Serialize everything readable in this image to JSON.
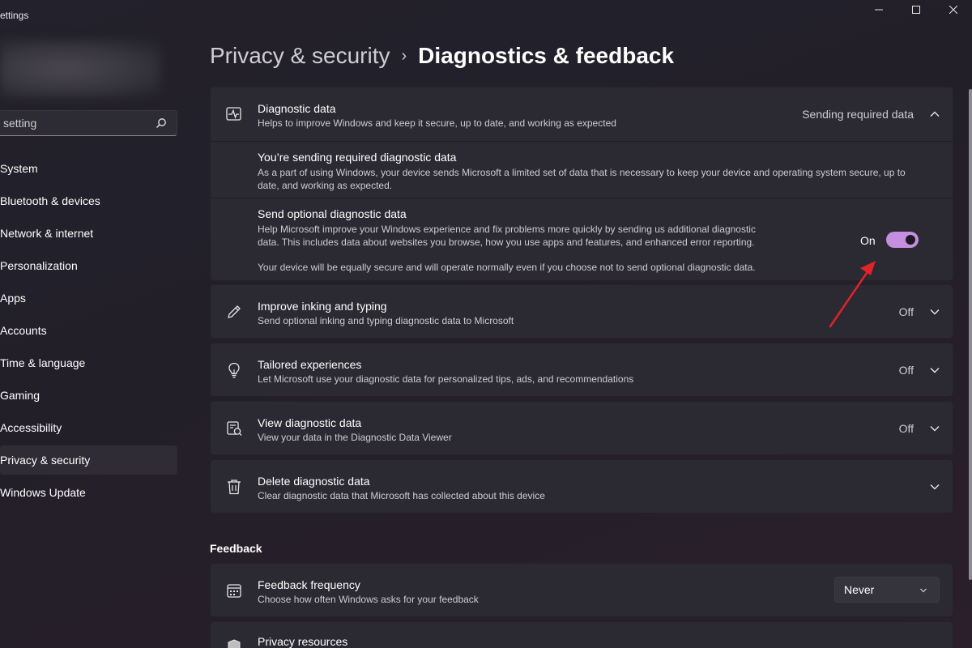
{
  "window": {
    "app_title": "ettings"
  },
  "sidebar": {
    "search_placeholder": "setting",
    "items": [
      {
        "label": "System"
      },
      {
        "label": "Bluetooth & devices"
      },
      {
        "label": "Network & internet"
      },
      {
        "label": "Personalization"
      },
      {
        "label": "Apps"
      },
      {
        "label": "Accounts"
      },
      {
        "label": "Time & language"
      },
      {
        "label": "Gaming"
      },
      {
        "label": "Accessibility"
      },
      {
        "label": "Privacy & security"
      },
      {
        "label": "Windows Update"
      }
    ],
    "active_index": 9
  },
  "breadcrumb": {
    "parent": "Privacy & security",
    "separator": "›",
    "current": "Diagnostics & feedback"
  },
  "diagnostic": {
    "title": "Diagnostic data",
    "desc": "Helps to improve Windows and keep it secure, up to date, and working as expected",
    "status": "Sending required data",
    "required": {
      "title": "You’re sending required diagnostic data",
      "line1": "As a part of using Windows, your device sends Microsoft a limited set of data that is necessary to keep your device and operating system secure, up to",
      "line2": "date, and working as expected."
    },
    "optional": {
      "title": "Send optional diagnostic data",
      "line1": "Help Microsoft improve your Windows experience and fix problems more quickly by sending us additional diagnostic",
      "line2": "data. This includes data about websites you browse, how you use apps and features, and enhanced error reporting.",
      "note": "Your device will be equally secure and will operate normally even if you choose not to send optional diagnostic data.",
      "toggle_label": "On"
    }
  },
  "inking": {
    "title": "Improve inking and typing",
    "desc": "Send optional inking and typing diagnostic data to Microsoft",
    "status": "Off"
  },
  "tailored": {
    "title": "Tailored experiences",
    "desc": "Let Microsoft use your diagnostic data for personalized tips, ads, and recommendations",
    "status": "Off"
  },
  "viewdata": {
    "title": "View diagnostic data",
    "desc": "View your data in the Diagnostic Data Viewer",
    "status": "Off"
  },
  "deletedata": {
    "title": "Delete diagnostic data",
    "desc": "Clear diagnostic data that Microsoft has collected about this device"
  },
  "feedback": {
    "header": "Feedback",
    "frequency": {
      "title": "Feedback frequency",
      "desc": "Choose how often Windows asks for your feedback",
      "value": "Never"
    },
    "privacy_resources": {
      "title": "Privacy resources"
    }
  },
  "colors": {
    "accent": "#c68ee0",
    "annotation_arrow": "#e0242a"
  }
}
